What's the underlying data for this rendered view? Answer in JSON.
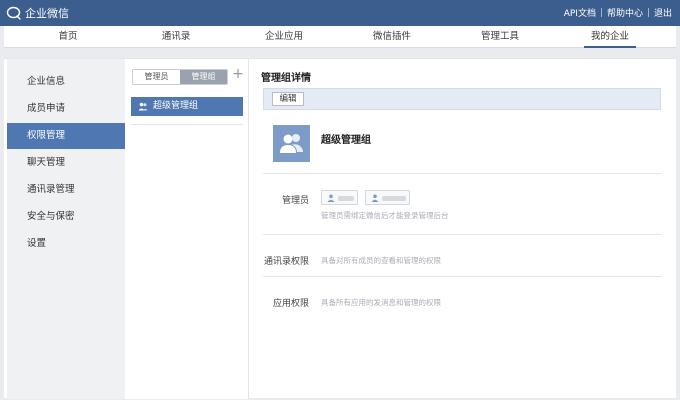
{
  "app": {
    "title": "企业微信",
    "icon": "chat-bubble-icon"
  },
  "top_links": {
    "api_docs": "API文档",
    "help_center": "帮助中心",
    "logout": "退出"
  },
  "nav": {
    "items": [
      {
        "label": "首页"
      },
      {
        "label": "通讯录"
      },
      {
        "label": "企业应用"
      },
      {
        "label": "微信插件"
      },
      {
        "label": "管理工具"
      },
      {
        "label": "我的企业",
        "active": true
      }
    ]
  },
  "sidebar": {
    "items": [
      {
        "label": "企业信息"
      },
      {
        "label": "成员申请"
      },
      {
        "label": "权限管理",
        "active": true
      },
      {
        "label": "聊天管理"
      },
      {
        "label": "通讯录管理"
      },
      {
        "label": "安全与保密"
      },
      {
        "label": "设置"
      }
    ]
  },
  "middle": {
    "tabs": [
      {
        "label": "管理员"
      },
      {
        "label": "管理组",
        "active": true
      }
    ],
    "add_label": "+",
    "groups": [
      {
        "label": "超级管理组",
        "icon": "group-icon"
      }
    ]
  },
  "detail": {
    "title": "管理组详情",
    "edit_label": "编辑",
    "group_name": "超级管理组",
    "admins": {
      "label": "管理员",
      "hint": "管理员需绑定微信后才能登录管理后台"
    },
    "contacts_perm": {
      "label": "通讯录权限",
      "desc": "具备对所有成员的查看和管理的权限"
    },
    "app_perm": {
      "label": "应用权限",
      "desc": "具备所有应用的发消息和管理的权限"
    }
  },
  "colors": {
    "header_bg": "#3c5e8e",
    "accent": "#4f77b1",
    "avatar_bg": "#7d9bc6"
  }
}
